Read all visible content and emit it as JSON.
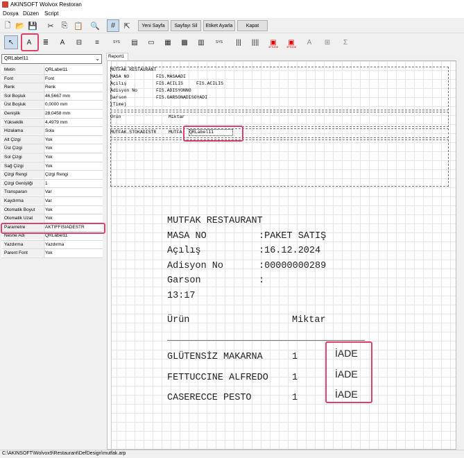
{
  "window": {
    "title": "AKINSOFT Wolvox Restoran"
  },
  "menu": [
    "Dosya",
    "Düzen",
    "Script"
  ],
  "toolbar": {
    "new_page": "Yeni Sayfa",
    "delete_page": "Sayfayı Sil",
    "label_settings": "Etiket Ayarla",
    "close": "Kapat"
  },
  "toolbar2": {
    "sys1": "SYS",
    "sys2": "SYS",
    "tag1": "3FS208",
    "tag2": "3FS208"
  },
  "component_select": "QRLabel11",
  "properties": [
    {
      "key": "Metin",
      "value": "QRLabel11"
    },
    {
      "key": "Font",
      "value": "Font"
    },
    {
      "key": "Renk",
      "value": "Renk"
    },
    {
      "key": "Sol Boşluk",
      "value": "46,5667 mm"
    },
    {
      "key": "Üst Boşluk",
      "value": "0,0000 mm"
    },
    {
      "key": "Genişlik",
      "value": "28,0458 mm"
    },
    {
      "key": "Yükseklik",
      "value": "4,4979 mm"
    },
    {
      "key": "Hizalama",
      "value": "Sola"
    },
    {
      "key": "Alt Çizgi",
      "value": "Yok"
    },
    {
      "key": "Üst Çizgi",
      "value": "Yok"
    },
    {
      "key": "Sol Çizgi",
      "value": "Yok"
    },
    {
      "key": "Sağ Çizgi",
      "value": "Yok"
    },
    {
      "key": "Çizgi Rengi",
      "value": "Çizgi Rengi"
    },
    {
      "key": "Çizgi Genişliği",
      "value": "1"
    },
    {
      "key": "Transparan",
      "value": "Var"
    },
    {
      "key": "Kaydırma",
      "value": "Var"
    },
    {
      "key": "Otomatik Boyut",
      "value": "Yok"
    },
    {
      "key": "Otomatik Uzat",
      "value": "Yok"
    },
    {
      "key": "Parametre",
      "value": "AKTIFFISIADESTR"
    },
    {
      "key": "Nesne Adı",
      "value": "QRLabel11"
    },
    {
      "key": "Yazdırma",
      "value": "Yazdırma"
    },
    {
      "key": "Parent Font",
      "value": "Yok"
    }
  ],
  "report_tab": "Report1",
  "design": {
    "header": [
      "MUTFAK RESTAURANT",
      "MASA NO",
      "Açılış",
      "Adisyon No",
      "Garson",
      "(Time)"
    ],
    "header_fields": [
      "FIS.MASAADI",
      "FIS.ACILIS",
      "FIS.ACILIS",
      "FIS.ADISYONNO",
      "FIS.GARSONADISOYADI"
    ],
    "col_urun": "Ürün",
    "col_miktar": "Miktar",
    "detail1": "MUTFAK.STOKADISTR",
    "detail2": "MUTFA",
    "detail_label": "QRLabel11"
  },
  "preview": {
    "title": "MUTFAK RESTAURANT",
    "rows": [
      {
        "label": "MASA NO",
        "value": ":PAKET SATIŞ"
      },
      {
        "label": "Açılış",
        "value": ":16.12.2024"
      },
      {
        "label": "Adisyon No",
        "value": ":00000000289"
      },
      {
        "label": "Garson",
        "value": ":"
      }
    ],
    "time": "13:17",
    "col_urun": "Ürün",
    "col_miktar": "Miktar",
    "separator": "______________________________________",
    "items": [
      {
        "name": "GLÜTENSİZ MAKARNA",
        "qty": "1",
        "flag": "İADE"
      },
      {
        "name": "FETTUCCINE ALFREDO",
        "qty": "1",
        "flag": "İADE"
      },
      {
        "name": "CASERECCE PESTO",
        "qty": "1",
        "flag": "İADE"
      }
    ]
  },
  "status_path": "C:\\AKINSOFT\\Wolvox9\\Restaurant\\DefDesign\\mutfak.arp",
  "colors": {
    "highlight": "#d9436b"
  }
}
